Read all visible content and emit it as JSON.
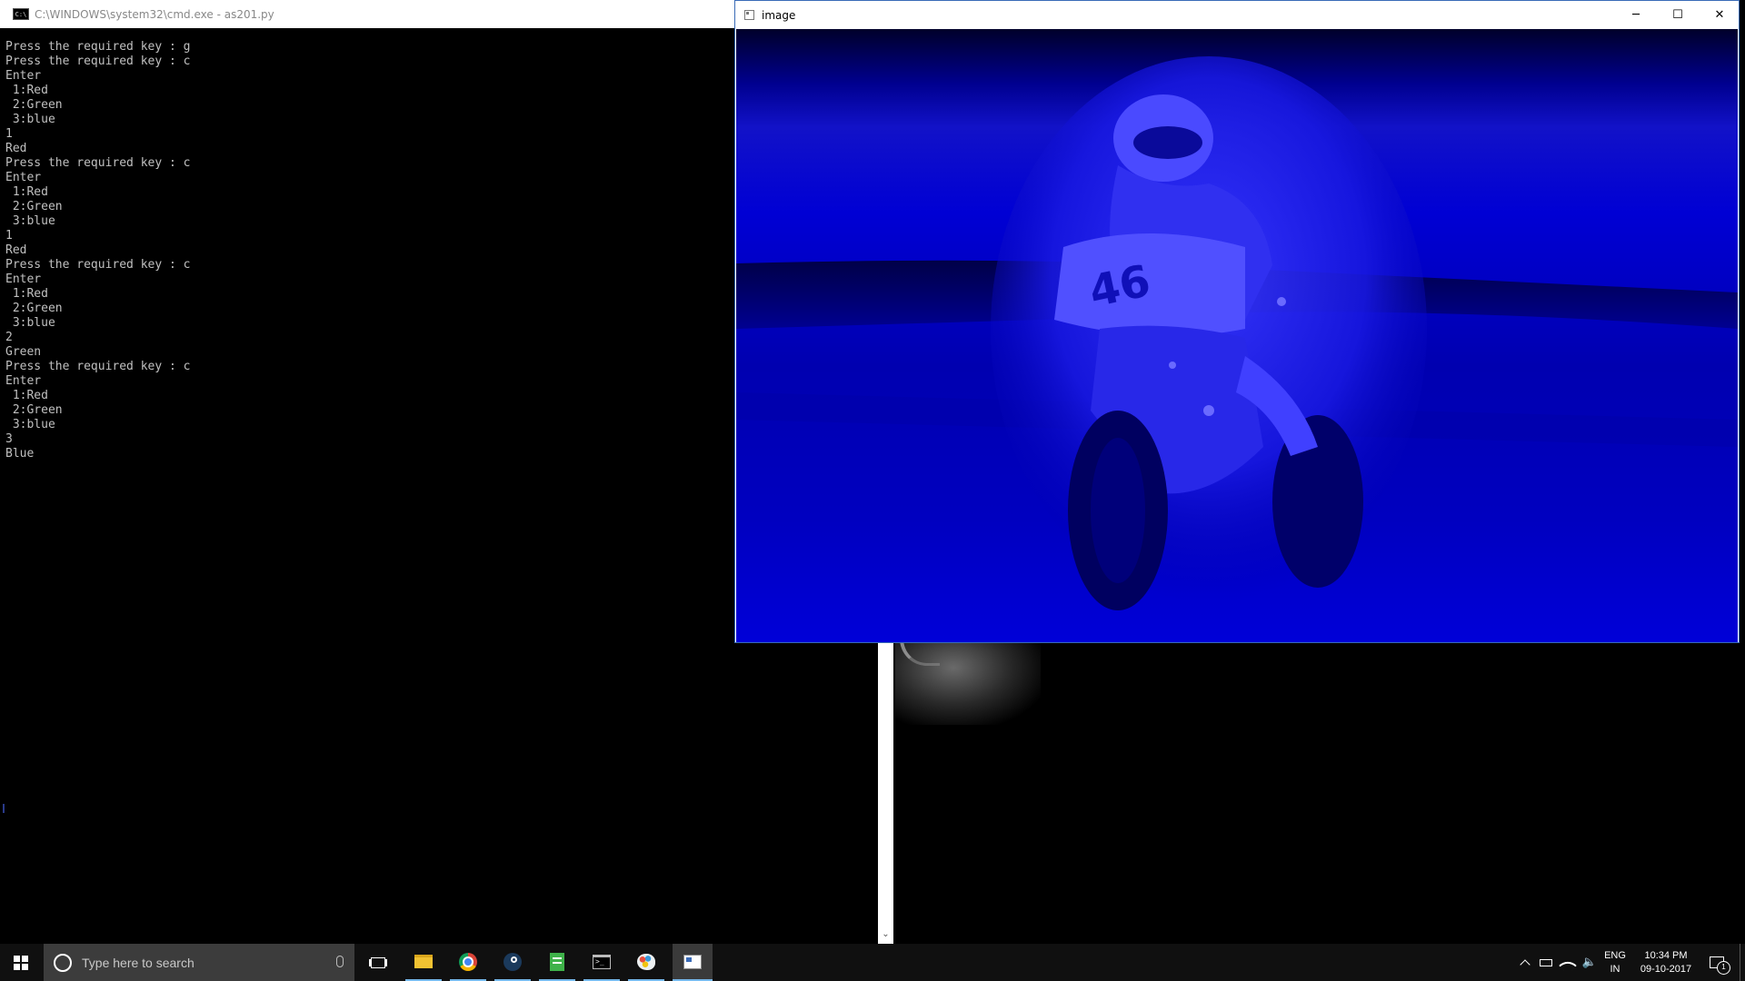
{
  "cmd_window": {
    "title": "C:\\WINDOWS\\system32\\cmd.exe - as201.py",
    "icon": "cmd-icon",
    "console_lines": [
      "Press the required key : g",
      "Press the required key : c",
      "Enter",
      " 1:Red",
      " 2:Green",
      " 3:blue",
      "1",
      "Red",
      "Press the required key : c",
      "Enter",
      " 1:Red",
      " 2:Green",
      " 3:blue",
      "1",
      "Red",
      "Press the required key : c",
      "Enter",
      " 1:Red",
      " 2:Green",
      " 3:blue",
      "2",
      "Green",
      "Press the required key : c",
      "Enter",
      " 1:Red",
      " 2:Green",
      " 3:blue",
      "3",
      "Blue"
    ]
  },
  "image_window": {
    "title": "image",
    "icon": "image-window-icon",
    "controls": {
      "minimize": "─",
      "maximize": "☐",
      "close": "✕"
    },
    "tint_color": "#0000d4"
  },
  "taskbar": {
    "background": "#101010",
    "search_placeholder": "Type here to search",
    "pinned_apps": [
      "task-view-icon",
      "file-explorer-icon",
      "chrome-icon",
      "steam-icon",
      "notepad-icon",
      "cmd-icon",
      "paint-icon",
      "image-viewer-icon"
    ],
    "tray": {
      "language": "ENG",
      "region": "IN",
      "time": "10:34 PM",
      "date": "09-10-2017",
      "notification_count": "1"
    }
  }
}
